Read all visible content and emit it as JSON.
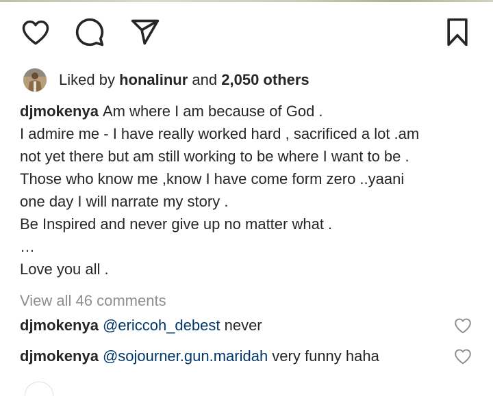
{
  "post": {
    "actions": {
      "like_icon": "heart-icon",
      "comment_icon": "comment-bubble-icon",
      "share_icon": "paper-plane-icon",
      "save_icon": "bookmark-icon"
    },
    "likes": {
      "prefix": "Liked by",
      "liker": "honalinur",
      "middle": "and",
      "others": "2,050 others"
    },
    "caption": {
      "username": "djmokenya",
      "lines": [
        "Am where I am because of God .",
        "I admire me - I have really worked hard , sacrificed a lot .am",
        "not yet there but am still working to be where I want to be .",
        "Those who know me ,know I have come form zero ..yaani",
        "one day I will narrate my story .",
        "Be Inspired and never give up no matter what .",
        "…",
        "Love you all ."
      ]
    },
    "view_all_comments": "View all 46 comments",
    "comments": [
      {
        "username": "djmokenya",
        "mention": "@ericcoh_debest",
        "text": " never"
      },
      {
        "username": "djmokenya",
        "mention": "@sojourner.gun.maridah",
        "text": " very funny haha"
      }
    ]
  }
}
